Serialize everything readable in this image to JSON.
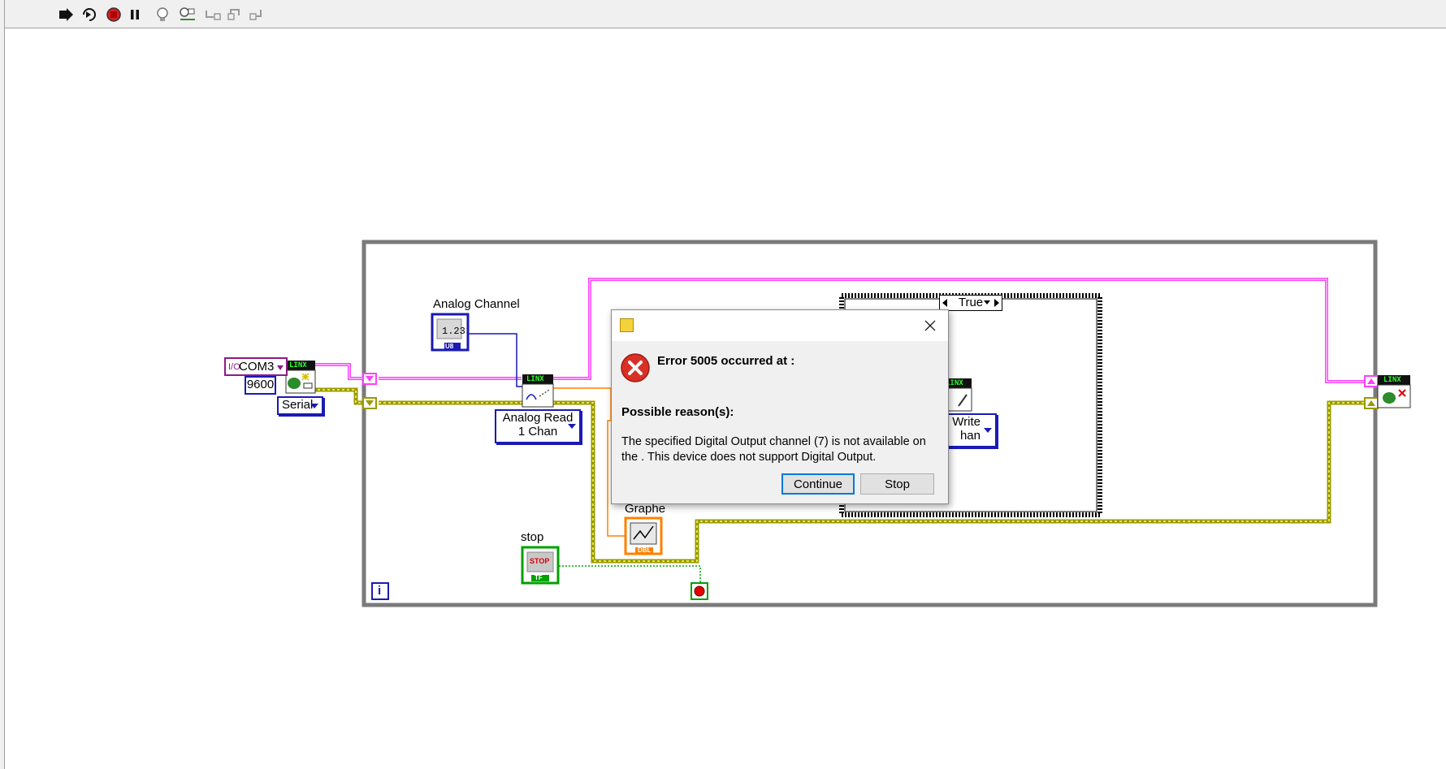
{
  "toolbar": {
    "buttons": [
      "run-icon",
      "run-continuously-icon",
      "abort-icon",
      "pause-icon",
      "highlight-execution-icon",
      "retain-wire-values-icon",
      "step-into-icon",
      "step-over-icon",
      "step-out-icon"
    ]
  },
  "diagram": {
    "visa_resource": "COM3",
    "baud_rate": "9600",
    "connection_type": "Serial",
    "analog_channel_label": "Analog Channel",
    "analog_channel_constant_type": "U8",
    "analog_channel_constant_text": "1.23",
    "linx_badge": "LINX",
    "analog_read_line1": "Analog Read",
    "analog_read_line2": "1 Chan",
    "case_selector": "True",
    "digital_write_line1": "Write",
    "digital_write_line2": "han",
    "graph_label": "Graphe",
    "stop_label": "stop",
    "stop_button_text": "STOP",
    "stop_type": "TF",
    "graph_type": "DBL",
    "iteration_terminal": "i",
    "wire_colors": {
      "visa": "#ff40ff",
      "error": "#b9b900",
      "numeric": "#1a1ab5",
      "dbl": "#ff8000",
      "bool": "#00a000"
    }
  },
  "dialog": {
    "heading": "Error 5005 occurred at :",
    "reason_title": "Possible reason(s):",
    "reason_text": "The specified Digital Output channel (7) is not available on the .  This device does not support  Digital Output.",
    "continue_label": "Continue",
    "stop_label": "Stop"
  }
}
